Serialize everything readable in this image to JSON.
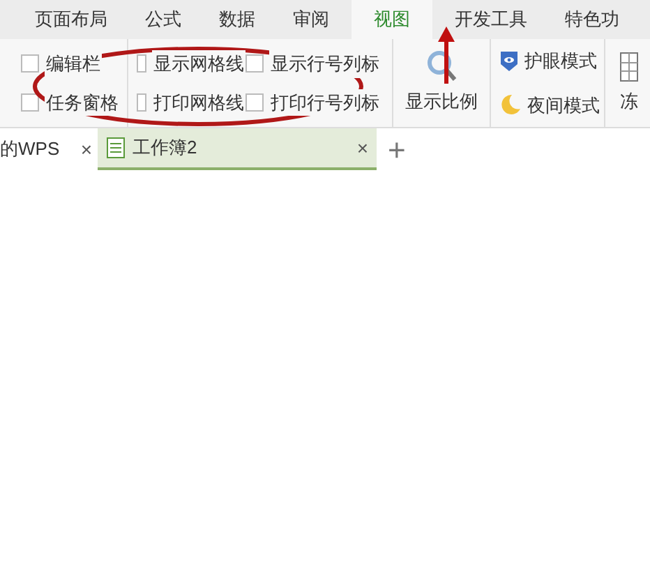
{
  "ribbon_tabs": [
    {
      "label": "页面布局",
      "selected": false
    },
    {
      "label": "公式",
      "selected": false
    },
    {
      "label": "数据",
      "selected": false
    },
    {
      "label": "审阅",
      "selected": false
    },
    {
      "label": "视图",
      "selected": true
    },
    {
      "label": "开发工具",
      "selected": false
    },
    {
      "label": "特色功",
      "selected": false
    }
  ],
  "checkbox_columns": [
    [
      {
        "label": "编辑栏",
        "checked": false
      },
      {
        "label": "任务窗格",
        "checked": false
      }
    ],
    [
      {
        "label": "显示网格线",
        "checked": false
      },
      {
        "label": "打印网格线",
        "checked": false
      }
    ],
    [
      {
        "label": "显示行号列标",
        "checked": false
      },
      {
        "label": "打印行号列标",
        "checked": false
      }
    ]
  ],
  "zoom_button": {
    "label": "显示比例"
  },
  "mode_buttons": [
    {
      "label": "护眼模式",
      "kind": "eye"
    },
    {
      "label": "夜间模式",
      "kind": "moon"
    }
  ],
  "freeze_button": {
    "label": "冻"
  },
  "doc_tabs": [
    {
      "label": "的WPS",
      "selected": false,
      "close": "×"
    },
    {
      "label": "工作簿2",
      "selected": true,
      "close": "×"
    }
  ],
  "new_tab": "+"
}
